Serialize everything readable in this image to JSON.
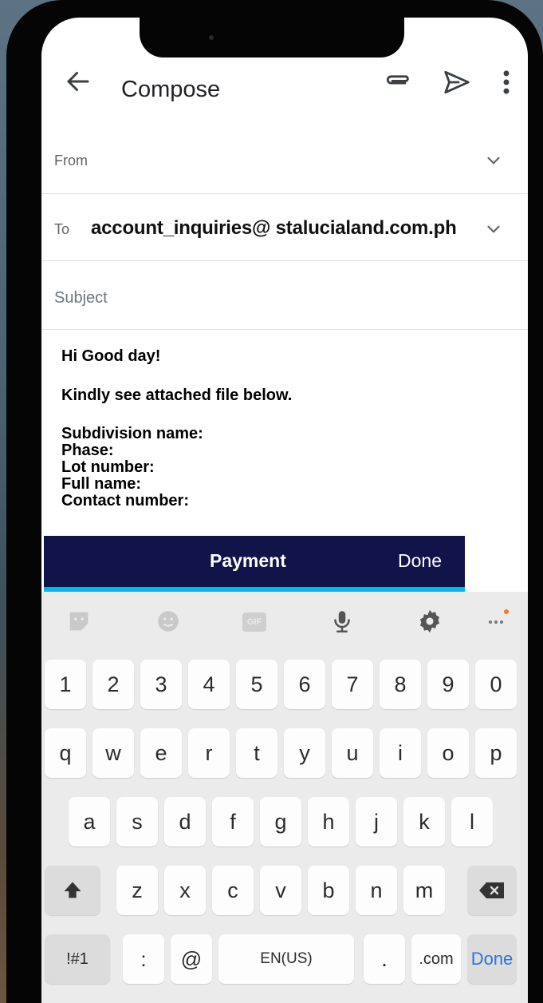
{
  "header": {
    "title": "Compose"
  },
  "fields": {
    "from_label": "From",
    "to_label": "To",
    "to_value": "account_inquiries@ stalucialand.com.ph",
    "subject_placeholder": "Subject"
  },
  "body": {
    "greeting": "Hi Good day!",
    "instruction": "Kindly see attached file below.",
    "details": [
      "Subdivision name:",
      "Phase:",
      "Lot number:",
      "Full name:",
      "Contact number:"
    ]
  },
  "attachment_bar": {
    "title": "Payment",
    "done_label": "Done"
  },
  "keyboard": {
    "toolbar": [
      "sticker-icon",
      "emoji-icon",
      "gif-icon",
      "mic-icon",
      "gear-icon",
      "more-icon"
    ],
    "gif_label": "GIF",
    "row_numbers": [
      "1",
      "2",
      "3",
      "4",
      "5",
      "6",
      "7",
      "8",
      "9",
      "0"
    ],
    "row_top": [
      "q",
      "w",
      "e",
      "r",
      "t",
      "y",
      "u",
      "i",
      "o",
      "p"
    ],
    "row_middle": [
      "a",
      "s",
      "d",
      "f",
      "g",
      "h",
      "j",
      "k",
      "l"
    ],
    "row_bottom": [
      "z",
      "x",
      "c",
      "v",
      "b",
      "n",
      "m"
    ],
    "sym_label": "!#1",
    "colon_label": ":",
    "at_label": "@",
    "space_label": "EN(US)",
    "period_label": ".",
    "dotcom_label": ".com",
    "done_label": "Done"
  },
  "colors": {
    "payment_bar": "#121449",
    "payment_accent": "#00b8ee",
    "done_key": "#2d74d8",
    "notification_dot": "#f07a2a"
  }
}
